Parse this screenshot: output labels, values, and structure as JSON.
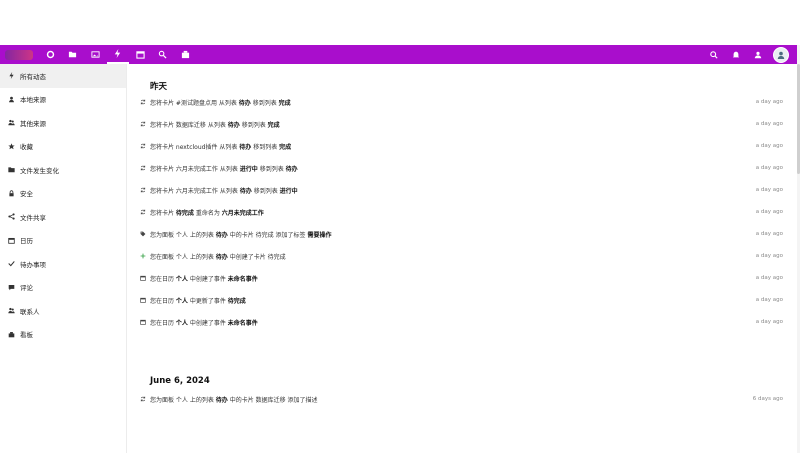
{
  "header": {
    "apps": [
      {
        "icon": "dashboard-icon",
        "active": false
      },
      {
        "icon": "files-icon",
        "active": false
      },
      {
        "icon": "photos-icon",
        "active": false
      },
      {
        "icon": "activity-icon",
        "active": true
      },
      {
        "icon": "calendar-icon",
        "active": false
      },
      {
        "icon": "contacts-icon",
        "active": false
      },
      {
        "icon": "deck-icon",
        "active": false
      }
    ],
    "right_icons": [
      "search-icon",
      "notifications-icon",
      "contacts-menu-icon"
    ],
    "brand_color": "#a90ecc"
  },
  "sidebar": {
    "items": [
      {
        "label": "所有动态",
        "icon": "lightning-icon",
        "active": true
      },
      {
        "label": "本地来源",
        "icon": "person-icon"
      },
      {
        "label": "其他来源",
        "icon": "people-icon"
      },
      {
        "label": "收藏",
        "icon": "star-icon"
      },
      {
        "label": "文件发生变化",
        "icon": "folder-icon"
      },
      {
        "label": "安全",
        "icon": "lock-icon"
      },
      {
        "label": "文件共享",
        "icon": "share-icon"
      },
      {
        "label": "日历",
        "icon": "calendar-icon"
      },
      {
        "label": "待办事项",
        "icon": "check-icon"
      },
      {
        "label": "评论",
        "icon": "comment-icon"
      },
      {
        "label": "联系人",
        "icon": "contacts-icon"
      },
      {
        "label": "看板",
        "icon": "deck-icon"
      }
    ]
  },
  "main": {
    "groups": [
      {
        "heading": "昨天",
        "items": [
          {
            "icon": "sync-icon",
            "parts": [
              "您将卡片 ",
              "#测试题盘点用",
              " 从列表 ",
              "待办",
              " 移到列表 ",
              "完成"
            ],
            "time": "a day ago"
          },
          {
            "icon": "sync-icon",
            "parts": [
              "您将卡片 ",
              "数据库迁移",
              " 从列表 ",
              "待办",
              " 移到列表 ",
              "完成"
            ],
            "time": "a day ago"
          },
          {
            "icon": "sync-icon",
            "parts": [
              "您将卡片 ",
              "nextcloud插件",
              " 从列表 ",
              "待办",
              " 移到列表 ",
              "完成"
            ],
            "time": "a day ago"
          },
          {
            "icon": "sync-icon",
            "parts": [
              "您将卡片 ",
              "六月未完成工作",
              " 从列表 ",
              "进行中",
              " 移到列表 ",
              "待办"
            ],
            "time": "a day ago"
          },
          {
            "icon": "sync-icon",
            "parts": [
              "您将卡片 ",
              "六月未完成工作",
              " 从列表 ",
              "待办",
              " 移到列表 ",
              "进行中"
            ],
            "time": "a day ago"
          },
          {
            "icon": "sync-icon",
            "parts": [
              "您将卡片 ",
              "待完成",
              " 重命名为 ",
              "六月未完成工作",
              "",
              ""
            ],
            "time": "a day ago"
          },
          {
            "icon": "tag-icon",
            "parts": [
              "您为面板 ",
              "个人",
              " 上的列表 ",
              "待办",
              " 中的卡片 ",
              "待完成",
              " 添加了标签 ",
              "需要操作"
            ],
            "time": "a day ago"
          },
          {
            "icon": "plus-icon",
            "parts": [
              "您在面板 ",
              "个人",
              " 上的列表 ",
              "待办",
              " 中创建了卡片 ",
              "待完成"
            ],
            "time": "a day ago"
          },
          {
            "icon": "calendar-icon",
            "parts": [
              "您在日历 ",
              "个人",
              " 中创建了事件 ",
              "未命名事件"
            ],
            "time": "a day ago"
          },
          {
            "icon": "calendar-icon",
            "parts": [
              "您在日历 ",
              "个人",
              " 中更新了事件 ",
              "待完成"
            ],
            "time": "a day ago"
          },
          {
            "icon": "calendar-icon",
            "parts": [
              "您在日历 ",
              "个人",
              " 中创建了事件 ",
              "未命名事件"
            ],
            "time": "a day ago"
          }
        ]
      },
      {
        "heading": "June 6, 2024",
        "items": [
          {
            "icon": "sync-icon",
            "parts": [
              "您为面板 ",
              "个人",
              " 上的列表 ",
              "待办",
              " 中的卡片 ",
              "数据库迁移",
              " 添加了描述",
              ""
            ],
            "time": "6 days ago"
          }
        ]
      }
    ]
  }
}
